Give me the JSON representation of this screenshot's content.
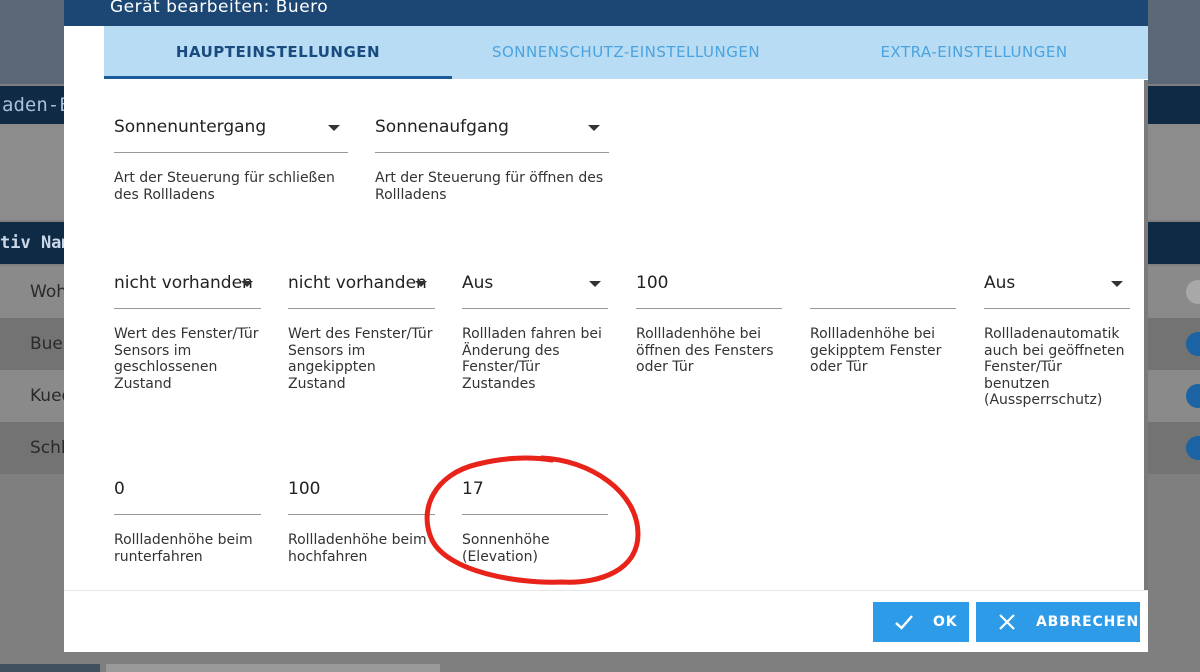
{
  "background": {
    "title_fragment": "aden-E",
    "table_header_fragment": "tiv Nam",
    "rows": [
      "Woh",
      "Buer",
      "Kueo",
      "Schl"
    ]
  },
  "dialog": {
    "title": "Gerät bearbeiten: Buero",
    "tabs": [
      "HAUPTEINSTELLUNGEN",
      "SONNENSCHUTZ-EINSTELLUNGEN",
      "EXTRA-EINSTELLUNGEN"
    ],
    "active_tab": 0,
    "row1": [
      {
        "value": "Sonnenuntergang",
        "help": "Art der Steuerung für schließen des Rollladens"
      },
      {
        "value": "Sonnenaufgang",
        "help": "Art der Steuerung für öffnen des Rollladens"
      }
    ],
    "row2": [
      {
        "value": "nicht vorhanden",
        "help": "Wert des Fenster/Tür Sensors im geschlossenen Zustand"
      },
      {
        "value": "nicht vorhanden",
        "help": "Wert des Fenster/Tür Sensors im angekippten Zustand"
      },
      {
        "value": "Aus",
        "help": "Rollladen fahren bei Änderung des Fenster/Tür Zustandes"
      },
      {
        "value": "100",
        "help": "Rollladenhöhe bei öffnen des Fensters oder Tür"
      },
      {
        "value": "",
        "help": "Rollladenhöhe bei gekipptem Fenster oder Tür"
      },
      {
        "value": "Aus",
        "help": "Rollladenautomatik auch bei geöffneten Fenster/Tür benutzen (Aussperrschutz)"
      }
    ],
    "row3": [
      {
        "value": "0",
        "help": "Rollladenhöhe beim runterfahren"
      },
      {
        "value": "100",
        "help": "Rollladenhöhe beim hochfahren"
      },
      {
        "value": "17",
        "help": "Sonnenhöhe (Elevation)"
      }
    ],
    "buttons": {
      "ok": "OK",
      "cancel": "ABBRECHEN"
    }
  },
  "colors": {
    "header": "#1c4673",
    "tabs_bg": "#b8dcf4",
    "button": "#2e9be8",
    "annotation": "#e8231a"
  }
}
